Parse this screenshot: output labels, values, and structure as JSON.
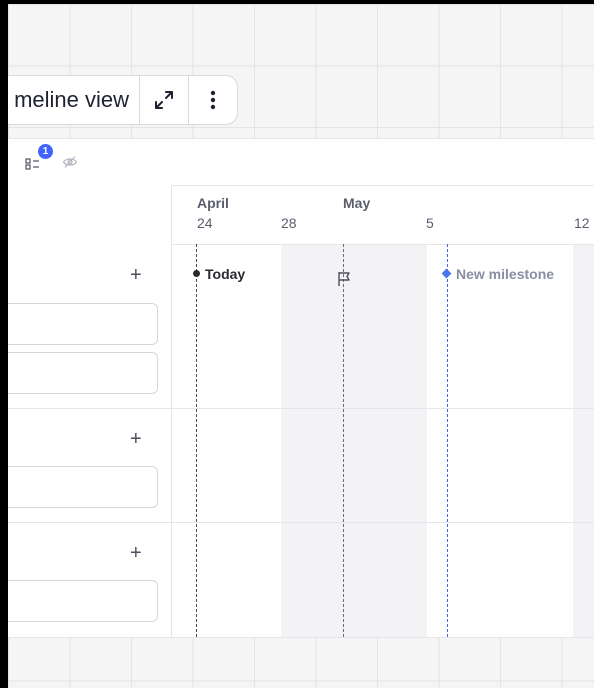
{
  "title_bar": {
    "title": "meline view",
    "expand_icon": "expand-arrows-icon",
    "more_icon": "more-vertical-icon"
  },
  "toolbar": {
    "filter_icon": "filter-list-icon",
    "filter_badge": "1",
    "hidden_icon": "eye-off-icon"
  },
  "timeline": {
    "months": [
      {
        "label": "April"
      },
      {
        "label": "May"
      }
    ],
    "days": [
      "24",
      "28",
      "5",
      "12"
    ],
    "today_label": "Today",
    "milestone_label": "New milestone",
    "flag_icon": "flag-icon"
  },
  "swimlanes": {
    "add_label": "+",
    "count": 3
  },
  "colors": {
    "accent": "#4262ff",
    "milestone": "#4a78e8"
  }
}
